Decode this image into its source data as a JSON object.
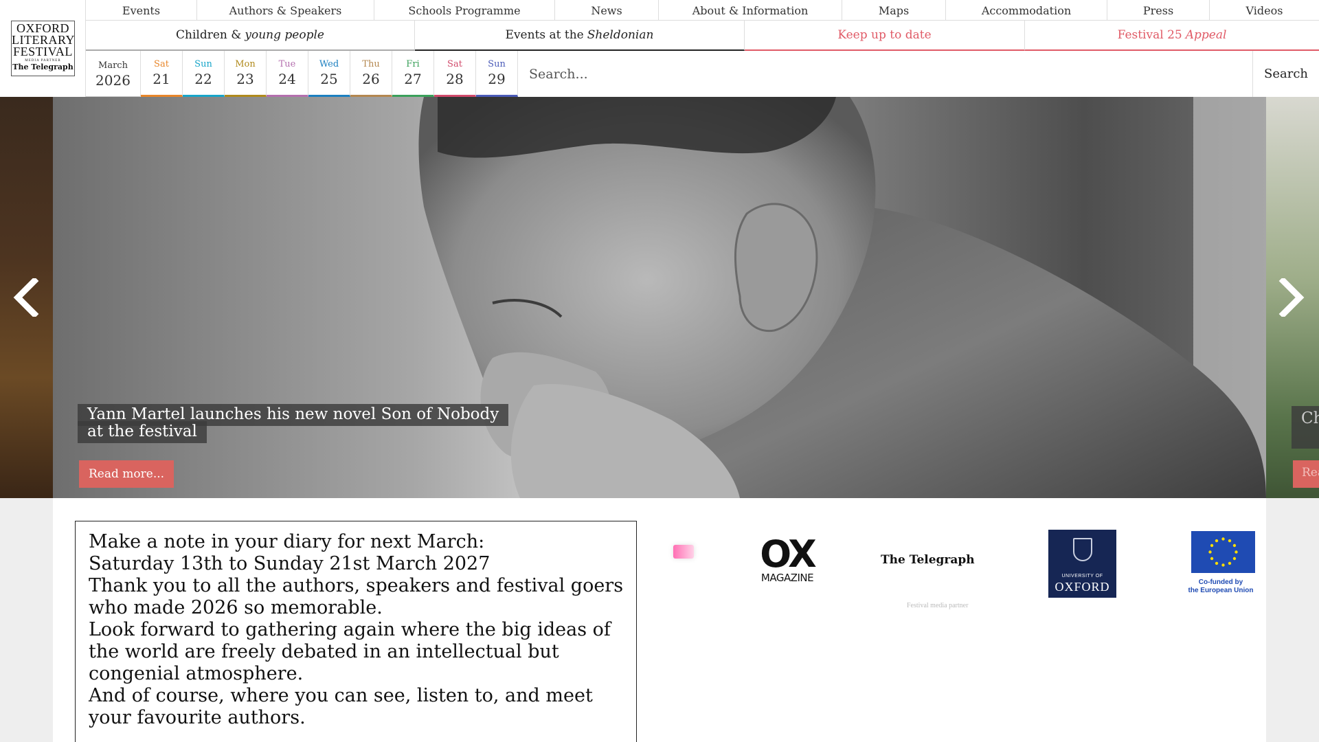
{
  "logo": {
    "line1": "OXFORD",
    "line2": "LITERARY",
    "line3": "FESTIVAL",
    "partner_label": "MEDIA PARTNER",
    "partner_name": "The Telegraph"
  },
  "nav_top": [
    {
      "label": "Events",
      "width": 162
    },
    {
      "label": "Authors & Speakers",
      "width": 258
    },
    {
      "label": "Schools Programme",
      "width": 263
    },
    {
      "label": "News",
      "width": 151
    },
    {
      "label": "About & Information",
      "width": 267
    },
    {
      "label": "Maps",
      "width": 151
    },
    {
      "label": "Accommodation",
      "width": 235
    },
    {
      "label": "Press",
      "width": 149
    },
    {
      "label": "Videos",
      "width": 159
    }
  ],
  "nav_second": {
    "children_prefix": "Children &",
    "children_italic": "young people",
    "sheldonian_prefix": "Events at the",
    "sheldonian_italic": "Sheldonian",
    "keep_up": "Keep up to date",
    "appeal_prefix": "Festival 25",
    "appeal_italic": "Appeal"
  },
  "datebar": {
    "month": "March",
    "year": "2026",
    "days": [
      {
        "name": "Sat",
        "num": "21",
        "color": "#e8862a"
      },
      {
        "name": "Sun",
        "num": "22",
        "color": "#17a5c9"
      },
      {
        "name": "Mon",
        "num": "23",
        "color": "#b08a1c"
      },
      {
        "name": "Tue",
        "num": "24",
        "color": "#b46fae"
      },
      {
        "name": "Wed",
        "num": "25",
        "color": "#1b7fc0"
      },
      {
        "name": "Thu",
        "num": "26",
        "color": "#b4874f"
      },
      {
        "name": "Fri",
        "num": "27",
        "color": "#3aa05a"
      },
      {
        "name": "Sat",
        "num": "28",
        "color": "#d14a6b"
      },
      {
        "name": "Sun",
        "num": "29",
        "color": "#4b5bb8"
      }
    ]
  },
  "search": {
    "placeholder": "Search...",
    "button_label": "Search"
  },
  "hero": {
    "caption": "Yann Martel launches his new novel Son of Nobody at the festival",
    "read_more": "Read more...",
    "next_caption_peek": "Ch ca",
    "next_read_peek": "Rea"
  },
  "notice": {
    "lines": [
      "Make a note in your diary for next March:",
      "Saturday 13th to Sunday 21st March 2027",
      "Thank you to all the authors, speakers and festival goers who made 2026 so memorable.",
      "Look forward to gathering again where the big ideas of the world are freely debated in an intellectual but congenial atmosphere.",
      "And of course, where you can see, listen to, and meet your favourite authors."
    ]
  },
  "sponsors": {
    "ox_big": "OX",
    "ox_small": "MAGAZINE",
    "telegraph": "The Telegraph",
    "oxford_small": "UNIVERSITY OF",
    "oxford_big": "OXFORD",
    "eu_line1": "Co-funded by",
    "eu_line2": "the European Union",
    "media_partner_caption": "Festival media partner"
  }
}
